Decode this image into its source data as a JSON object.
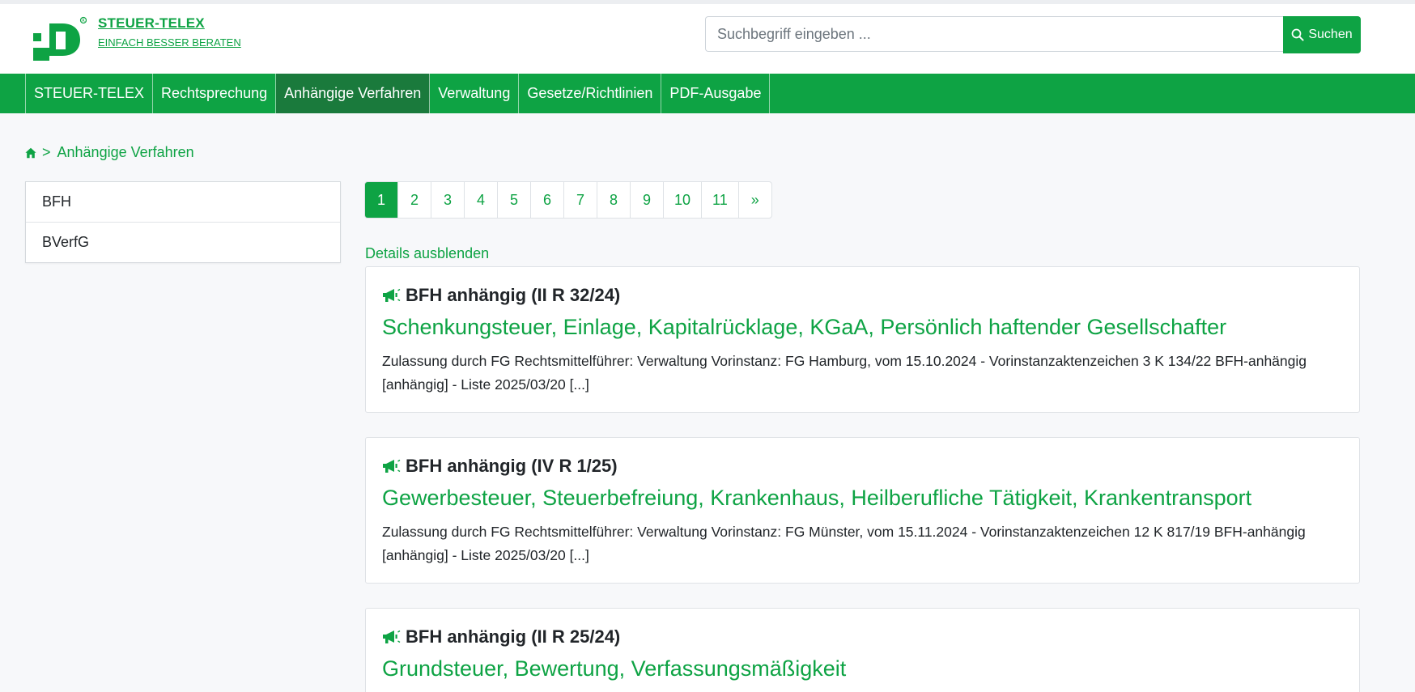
{
  "brand": {
    "title": "STEUER-TELEX",
    "subtitle": "EINFACH BESSER BERATEN",
    "logo_icon": "steuer-telex-logo",
    "accent_color": "#0ea344"
  },
  "search": {
    "placeholder": "Suchbegriff eingeben ...",
    "value": "",
    "button_label": "Suchen",
    "button_icon": "search-icon"
  },
  "nav": {
    "items": [
      {
        "label": "STEUER-TELEX",
        "active": false
      },
      {
        "label": "Rechtsprechung",
        "active": false
      },
      {
        "label": "Anhängige Verfahren",
        "active": true
      },
      {
        "label": "Verwaltung",
        "active": false
      },
      {
        "label": "Gesetze/Richtlinien",
        "active": false
      },
      {
        "label": "PDF-Ausgabe",
        "active": false
      }
    ],
    "active_color": "#1a7a3c"
  },
  "breadcrumb": {
    "home_icon": "home-icon",
    "separator": ">",
    "current": "Anhängige Verfahren"
  },
  "sidebar": {
    "items": [
      {
        "label": "BFH"
      },
      {
        "label": "BVerfG"
      }
    ]
  },
  "pagination": {
    "pages": [
      "1",
      "2",
      "3",
      "4",
      "5",
      "6",
      "7",
      "8",
      "9",
      "10",
      "11"
    ],
    "current": "1",
    "next_label": "»"
  },
  "details_toggle": "Details ausblenden",
  "entries": [
    {
      "icon": "megaphone-icon",
      "heading": "BFH anhängig (II R 32/24)",
      "title": "Schenkungsteuer, Einlage, Kapitalrücklage, KGaA, Persönlich haftender Gesellschafter",
      "text": "Zulassung durch FG Rechtsmittelführer: Verwaltung Vorinstanz: FG Hamburg, vom 15.10.2024 - Vorinstanzaktenzeichen 3 K 134/22 BFH-anhängig [anhängig] - Liste 2025/03/20 [...]"
    },
    {
      "icon": "megaphone-icon",
      "heading": "BFH anhängig (IV R 1/25)",
      "title": "Gewerbesteuer, Steuerbefreiung, Krankenhaus, Heilberufliche Tätigkeit, Krankentransport",
      "text": "Zulassung durch FG Rechtsmittelführer: Verwaltung Vorinstanz: FG Münster, vom 15.11.2024 - Vorinstanzaktenzeichen 12 K 817/19 BFH-anhängig [anhängig] - Liste 2025/03/20 [...]"
    },
    {
      "icon": "megaphone-icon",
      "heading": "BFH anhängig (II R 25/24)",
      "title": "Grundsteuer, Bewertung, Verfassungsmäßigkeit",
      "text": ""
    }
  ]
}
